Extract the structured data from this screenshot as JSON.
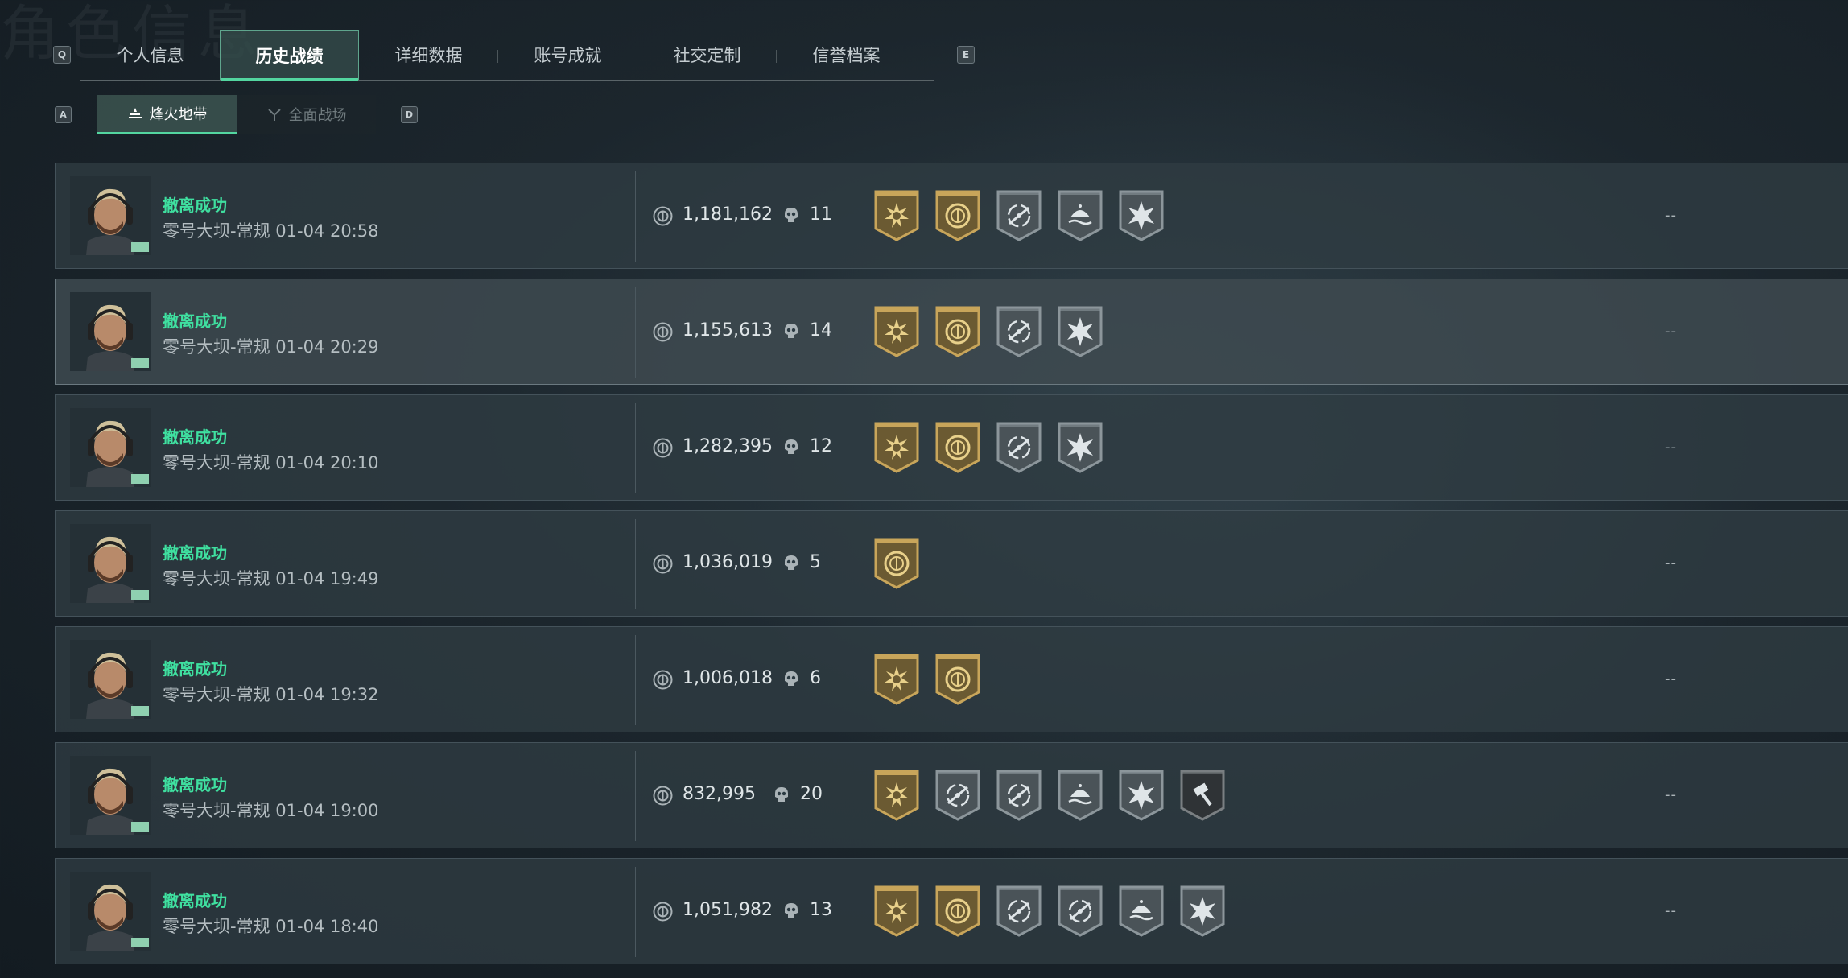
{
  "background_title": "角色信息",
  "keys": {
    "prev_tab": "Q",
    "next_tab": "E",
    "prev_mode": "A",
    "next_mode": "D"
  },
  "tabs": [
    {
      "label": "个人信息",
      "active": false
    },
    {
      "label": "历史战绩",
      "active": true
    },
    {
      "label": "详细数据",
      "active": false
    },
    {
      "label": "账号成就",
      "active": false
    },
    {
      "label": "社交定制",
      "active": false
    },
    {
      "label": "信誉档案",
      "active": false
    }
  ],
  "mode_tabs": [
    {
      "label": "烽火地带",
      "active": true
    },
    {
      "label": "全面战场",
      "active": false
    }
  ],
  "colors": {
    "accent": "#53d6a0",
    "status_green": "#3fe0a0",
    "gold": "#c8a55a",
    "silver": "#8c969b"
  },
  "records": [
    {
      "status": "撤离成功",
      "map": "零号大坝-常规",
      "time": "01-04 20:58",
      "value": "1,181,162",
      "kills": "11",
      "badges": [
        "gold-sun",
        "gold-coin",
        "silver-crosshair",
        "silver-wave",
        "silver-burst"
      ],
      "extra": "--"
    },
    {
      "status": "撤离成功",
      "map": "零号大坝-常规",
      "time": "01-04 20:29",
      "value": "1,155,613",
      "kills": "14",
      "badges": [
        "gold-sun",
        "gold-coin",
        "silver-crosshair",
        "silver-burst"
      ],
      "extra": "--"
    },
    {
      "status": "撤离成功",
      "map": "零号大坝-常规",
      "time": "01-04 20:10",
      "value": "1,282,395",
      "kills": "12",
      "badges": [
        "gold-sun",
        "gold-coin",
        "silver-crosshair",
        "silver-burst"
      ],
      "extra": "--"
    },
    {
      "status": "撤离成功",
      "map": "零号大坝-常规",
      "time": "01-04 19:49",
      "value": "1,036,019",
      "kills": "5",
      "badges": [
        "gold-coin"
      ],
      "extra": "--"
    },
    {
      "status": "撤离成功",
      "map": "零号大坝-常规",
      "time": "01-04 19:32",
      "value": "1,006,018",
      "kills": "6",
      "badges": [
        "gold-sun",
        "gold-coin"
      ],
      "extra": "--"
    },
    {
      "status": "撤离成功",
      "map": "零号大坝-常规",
      "time": "01-04 19:00",
      "value": "832,995",
      "kills": "20",
      "badges": [
        "gold-sun",
        "silver-crosshair",
        "silver-crosshair",
        "silver-wave",
        "silver-burst",
        "dark-hammer"
      ],
      "extra": "--"
    },
    {
      "status": "撤离成功",
      "map": "零号大坝-常规",
      "time": "01-04 18:40",
      "value": "1,051,982",
      "kills": "13",
      "badges": [
        "gold-sun",
        "gold-coin",
        "silver-crosshair",
        "silver-crosshair",
        "silver-wave",
        "silver-burst"
      ],
      "extra": "--"
    }
  ]
}
